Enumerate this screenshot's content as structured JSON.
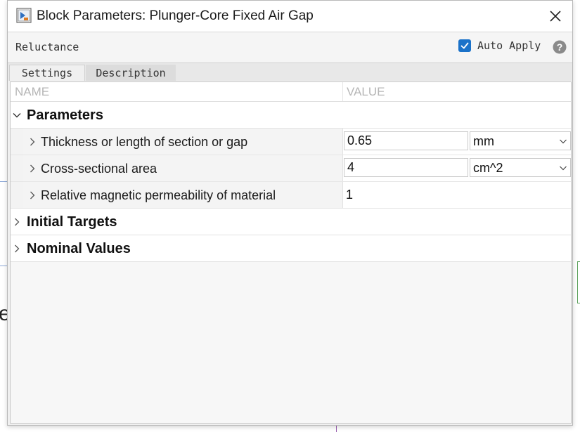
{
  "window": {
    "title": "Block Parameters: Plunger-Core Fixed Air Gap"
  },
  "toolbar": {
    "block_name": "Reluctance",
    "auto_apply_label": "Auto Apply",
    "auto_apply_checked": true
  },
  "tabs": [
    {
      "label": "Settings",
      "active": true
    },
    {
      "label": "Description",
      "active": false
    }
  ],
  "table": {
    "columns": {
      "name": "NAME",
      "value": "VALUE"
    },
    "groups": [
      {
        "label": "Parameters",
        "expanded": true,
        "params": [
          {
            "label": "Thickness or length of section or gap",
            "value": "0.65",
            "unit": "mm"
          },
          {
            "label": "Cross-sectional area",
            "value": "4",
            "unit": "cm^2"
          },
          {
            "label": "Relative magnetic permeability of material",
            "value": "1",
            "unit": ""
          }
        ]
      },
      {
        "label": "Initial Targets",
        "expanded": false
      },
      {
        "label": "Nominal Values",
        "expanded": false
      }
    ]
  },
  "background": {
    "partial_letter": "e"
  },
  "colors": {
    "accent": "#1b72c9",
    "header_text": "#b6b6b6"
  },
  "icons": [
    "simulink-block-icon",
    "close-icon",
    "checkmark-icon",
    "help-icon",
    "chevron-down-icon",
    "chevron-right-icon",
    "dropdown-caret-icon"
  ]
}
